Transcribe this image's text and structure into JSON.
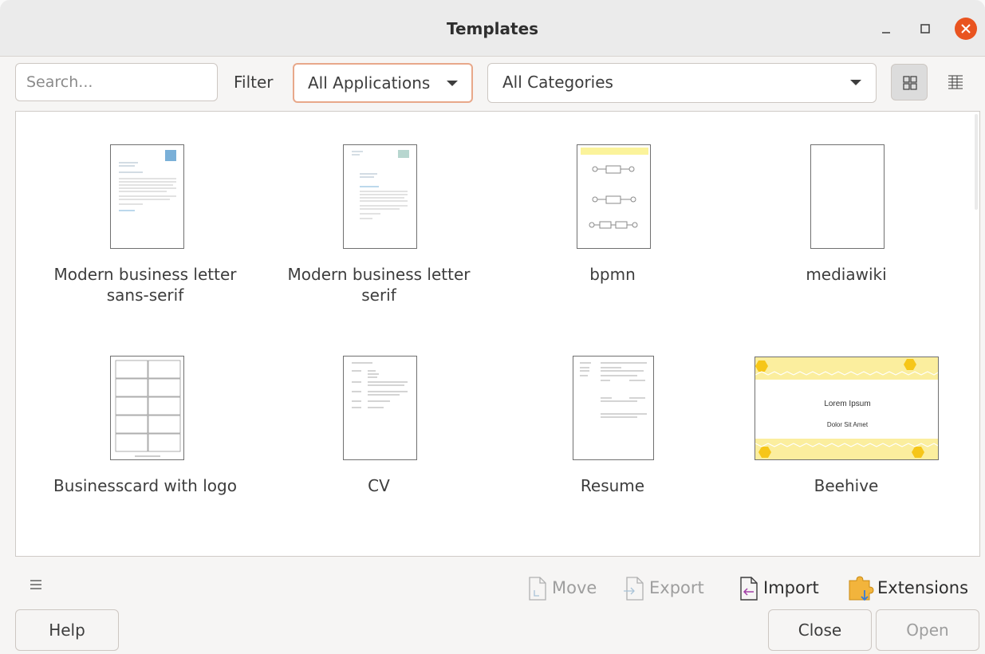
{
  "window": {
    "title": "Templates",
    "minimize_icon": "minimize-icon",
    "maximize_icon": "maximize-icon",
    "close_icon": "close-icon",
    "close_color": "#e95420"
  },
  "toolbar": {
    "search_placeholder": "Search...",
    "filter_label": "Filter",
    "application_filter": "All Applications",
    "category_filter": "All Categories",
    "thumbnail_view_icon": "grid-view-icon",
    "list_view_icon": "list-view-icon",
    "focus_color": "#e8a88a"
  },
  "templates": [
    {
      "name": "Modern business letter sans-serif",
      "line1": "Modern business letter",
      "line2": "sans-serif"
    },
    {
      "name": "Modern business letter serif",
      "line1": "Modern business letter",
      "line2": "serif"
    },
    {
      "name": "bpmn",
      "line1": "bpmn",
      "line2": ""
    },
    {
      "name": "mediawiki",
      "line1": "mediawiki",
      "line2": ""
    },
    {
      "name": "Businesscard with logo",
      "line1": "Businesscard with logo",
      "line2": ""
    },
    {
      "name": "CV",
      "line1": "CV",
      "line2": ""
    },
    {
      "name": "Resume",
      "line1": "Resume",
      "line2": ""
    },
    {
      "name": "Beehive",
      "line1": "Beehive",
      "line2": "",
      "preview_title": "Lorem Ipsum",
      "preview_subtitle": "Dolor Sit Amet",
      "preview_color": "#f5e17a"
    }
  ],
  "actions": {
    "menu_icon": "hamburger-menu-icon",
    "move": "Move",
    "export": "Export",
    "import": "Import",
    "extensions": "Extensions",
    "move_icon": "move-document-icon",
    "export_icon": "export-document-icon",
    "import_icon": "import-document-icon",
    "extensions_icon": "puzzle-extensions-icon"
  },
  "buttons": {
    "help": "Help",
    "close": "Close",
    "open": "Open"
  }
}
